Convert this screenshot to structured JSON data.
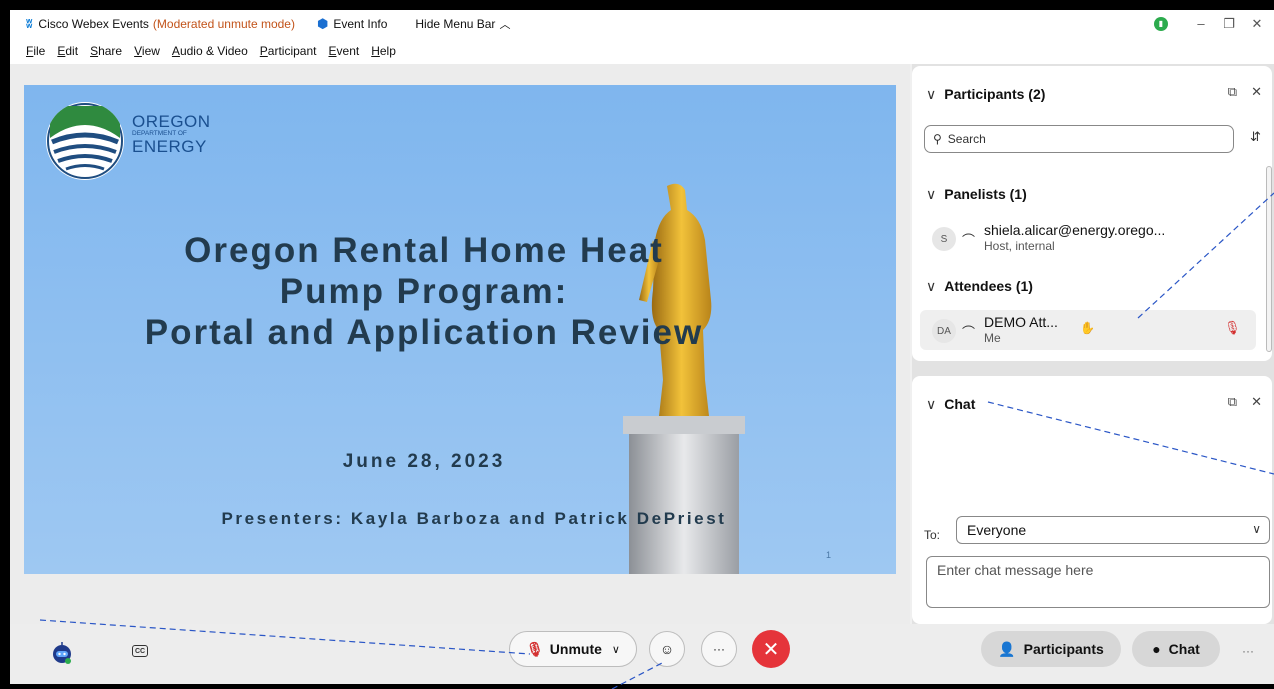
{
  "titlebar": {
    "app_name": "Cisco Webex Events",
    "mode": "(Moderated unmute mode)",
    "event_info": "Event Info",
    "hide_menu": "Hide Menu Bar",
    "minimize": "–",
    "restore": "❐",
    "close": "✕"
  },
  "menubar": [
    "File",
    "Edit",
    "Share",
    "View",
    "Audio & Video",
    "Participant",
    "Event",
    "Help"
  ],
  "slide": {
    "org_line1": "OREGON",
    "org_line2": "DEPARTMENT OF",
    "org_line3": "ENERGY",
    "title_line1": "Oregon Rental Home Heat",
    "title_line2": "Pump Program:",
    "title_line3": "Portal and Application Review",
    "date": "June 28, 2023",
    "presenters": "Presenters: Kayla Barboza and Patrick DePriest",
    "page_number": "1"
  },
  "participants_panel": {
    "title": "Participants (2)",
    "search_placeholder": "Search",
    "panelists_header": "Panelists (1)",
    "panelist": {
      "initials": "S",
      "name": "shiela.alicar@energy.orego...",
      "role": "Host, internal"
    },
    "attendees_header": "Attendees (1)",
    "attendee": {
      "initials": "DA",
      "name": "DEMO Att...",
      "role": "Me"
    }
  },
  "chat_panel": {
    "title": "Chat",
    "to_label": "To:",
    "to_value": "Everyone",
    "input_placeholder": "Enter chat message here"
  },
  "bottombar": {
    "cc_label": "CC",
    "unmute_label": "Unmute",
    "more_label": "···",
    "leave_label": "✕",
    "participants_label": "Participants",
    "chat_label": "Chat",
    "overflow_label": "···"
  },
  "colors": {
    "mode_text": "#c2531a",
    "leave_button": "#e5343a",
    "muted_mic": "#d32f2f",
    "slide_title": "#223b4e",
    "slide_sky": "#8dbef0",
    "annotation_line": "#2a56c6"
  }
}
